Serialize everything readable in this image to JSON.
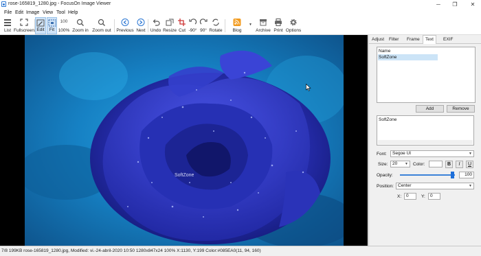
{
  "window": {
    "title": "rose-165819_1280.jpg - FocusOn Image Viewer",
    "controls": {
      "minimize": "─",
      "maximize": "❐",
      "close": "✕"
    }
  },
  "menu": [
    "File",
    "Edit",
    "Image",
    "View",
    "Tool",
    "Help"
  ],
  "toolbar": {
    "list": "List",
    "fullscreen": "Fullscreen",
    "edit": "Edit",
    "fit": "Fit",
    "zoom100": "100%",
    "zoom100_glyph": "100",
    "zoom_in": "Zoom in",
    "zoom_out": "Zoom out",
    "previous": "Previous",
    "next": "Next",
    "undo": "Undo",
    "resize": "Resize",
    "cut": "Cut",
    "rot_left": "-90°",
    "rot_right": "90°",
    "rotate": "Rotate",
    "blog": "Blog",
    "archive": "Archive",
    "print": "Print",
    "options": "Options"
  },
  "image": {
    "overlay_text": "SoftZone"
  },
  "panel": {
    "tabs": [
      "Adjust",
      "Filter",
      "Frame",
      "Text",
      "EXIF"
    ],
    "active_tab": "Text",
    "list_header": "Name",
    "list_items": [
      "SoftZone"
    ],
    "add": "Add",
    "remove": "Remove",
    "text_value": "SoftZone",
    "font_label": "Font:",
    "font_value": "Segoe UI",
    "size_label": "Size:",
    "size_value": "20",
    "color_label": "Color:",
    "color_value": "#ffffff",
    "bold": "B",
    "italic": "I",
    "underline": "U",
    "opacity_label": "Opacity:",
    "opacity_value": "100",
    "position_label": "Position:",
    "position_value": "Center",
    "x_label": "X:",
    "x_value": "0",
    "y_label": "Y:",
    "y_value": "0"
  },
  "status": "7/8   199KB  rose-165819_1280.jpg, Modified: vi.-24-abril-2020 10:50  1280x847x24  100%  X:1130, Y:199 Color:#085EA0(11, 94, 160)",
  "colors": {
    "accent": "#2a76d3",
    "active_tool": "#cfe3f7",
    "rose": "#2a2fb8",
    "background_blue": "#1a77b8"
  }
}
